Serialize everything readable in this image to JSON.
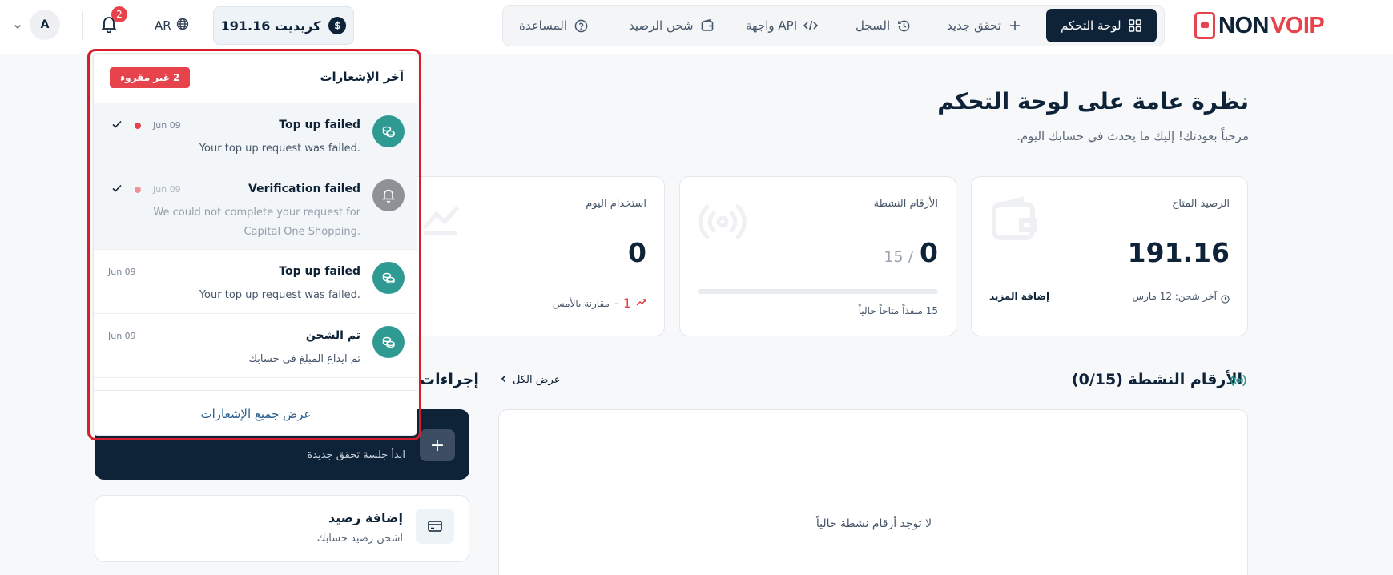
{
  "brand": {
    "name_part1": "NON",
    "name_part2": "VOIP"
  },
  "nav": {
    "dashboard": "لوحة التحكم",
    "new_verification": "تحقق جديد",
    "history": "السجل",
    "api": "واجهة API",
    "top_up": "شحن الرصيد",
    "help": "المساعدة"
  },
  "header": {
    "credits": "191.16 كريديت",
    "currency_symbol": "$",
    "language": "AR",
    "notification_count": "2",
    "avatar_initial": "A"
  },
  "page": {
    "title": "نظرة عامة على لوحة التحكم",
    "subtitle": "مرحباً بعودتك! إليك ما يحدث في حسابك اليوم."
  },
  "stats": {
    "balance": {
      "label": "الرصيد المتاح",
      "value": "191.16",
      "last_topup": "آخر شحن: 12 مارس",
      "add_more": "إضافة المزيد"
    },
    "active_numbers": {
      "label": "الأرقام النشطة",
      "value": "0",
      "max": "15 /",
      "slots": "15 منفذاً متاحاً حالياً",
      "progress": 0
    },
    "today_usage": {
      "label": "استخدام اليوم",
      "value": "0",
      "delta": "1 -",
      "delta_label": "مقارنة بالأمس"
    }
  },
  "active_numbers_section": {
    "title": "الأرقام النشطة (0/15)",
    "view_all": "عرض الكل",
    "empty": "لا توجد أرقام نشطة حالياً"
  },
  "actions_section": {
    "title": "إجراءات",
    "new_session_sub": "ابدأ جلسة تحقق جديدة",
    "add_balance_title": "إضافة رصيد",
    "add_balance_sub": "اشحن رصيد حسابك"
  },
  "notifications": {
    "title": "آخر الإشعارات",
    "unread_badge": "2 غير مقروء",
    "view_all": "عرض جميع الإشعارات",
    "items": [
      {
        "title": "Top up failed",
        "message": "Your top up request was failed.",
        "date": "Jun 09"
      },
      {
        "title": "Verification failed",
        "message_line1": "We could not complete your request for",
        "message_line2": "Capital One Shopping.",
        "date": "Jun 09"
      },
      {
        "title": "Top up failed",
        "message": "Your top up request was failed.",
        "date": "Jun 09"
      },
      {
        "title": "تم الشحن",
        "message": "تم ايداع المبلغ في حسابك",
        "date": "Jun 09"
      }
    ]
  },
  "colors": {
    "navy": "#0f2338",
    "red": "#e6434d",
    "teal": "#2f9a92",
    "gray_avatar": "#8e9296"
  }
}
